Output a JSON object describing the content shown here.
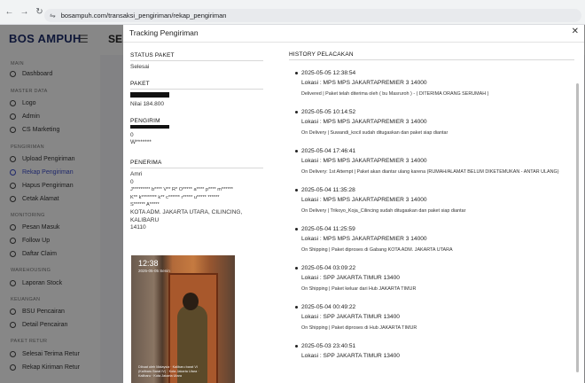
{
  "browser": {
    "url": "bosampuh.com/transaksi_pengiriman/rekap_pengiriman"
  },
  "sidebar": {
    "brand": "BOS AMPUH",
    "sections": [
      {
        "label": "MAIN"
      },
      {
        "label": "MASTER DATA"
      },
      {
        "label": "PENGIRIMAN"
      },
      {
        "label": "MONITORING"
      },
      {
        "label": "WAREHOUSING"
      },
      {
        "label": "KEUANGAN"
      },
      {
        "label": "PAKET RETUR"
      }
    ],
    "items": [
      {
        "label": "Dashboard"
      },
      {
        "label": "Logo"
      },
      {
        "label": "Admin"
      },
      {
        "label": "CS Marketing"
      },
      {
        "label": "Upload Pengiriman"
      },
      {
        "label": "Rekap Pengiriman"
      },
      {
        "label": "Hapus Pengiriman"
      },
      {
        "label": "Cetak Alamat"
      },
      {
        "label": "Pesan Masuk"
      },
      {
        "label": "Follow Up"
      },
      {
        "label": "Daftar Claim"
      },
      {
        "label": "Laporan Stock"
      },
      {
        "label": "BSU Pencairan"
      },
      {
        "label": "Detail Pencairan"
      },
      {
        "label": "Selesai Terima Retur"
      },
      {
        "label": "Rekap Kiriman Retur"
      }
    ]
  },
  "background": {
    "title": "SE"
  },
  "modal": {
    "title": "Tracking Pengiriman",
    "status_label": "STATUS PAKET",
    "status_value": "Selesai",
    "paket_label": "PAKET",
    "paket_value": "Nilai 184.800",
    "pengirim_label": "PENGIRIM",
    "pengirim_line1": "0",
    "pengirim_line2": "W*******",
    "penerima_label": "PENERIMA",
    "penerima_name": "Amri",
    "penerima_phone": "0",
    "penerima_addr1": "J********* b**** V** R* O***** a**** p**** m******",
    "penerima_addr2": "K** k******** k** c****** r***** u***** ******",
    "penerima_addr3": "S****** A*****",
    "penerima_city": "KOTA ADM. JAKARTA UTARA, CILINCING,",
    "penerima_district": "KALIBARU",
    "penerima_zip": "14110",
    "photo": {
      "time": "12:38",
      "date": "2025-05-05 Senin",
      "caption": "Dibuat oleh Malaysia · Kalibaru barat VI (Kalibaru Barat IV) · Kota Jakarta Utara · Kalibaru · Kota Jakarta Utara"
    },
    "history_label": "HISTORY PELACAKAN",
    "history": [
      {
        "date": "2025-05-05 12:38:54",
        "loc": "Lokasi : MPS MPS JAKARTAPREMIER 3 14000",
        "status": "Delivered | Paket telah diterima oleh ( bu Masruroh ) - ( DITERIMA ORANG SERUMAH )"
      },
      {
        "date": "2025-05-05 10:14:52",
        "loc": "Lokasi : MPS MPS JAKARTAPREMIER 3 14000",
        "status": "On Delivery | Suwandi_kocil sudah ditugaskan dan paket siap diantar"
      },
      {
        "date": "2025-05-04 17:46:41",
        "loc": "Lokasi : MPS MPS JAKARTAPREMIER 3 14000",
        "status": "On Delivery: 1st Attempt | Paket akan diantar ulang karena (RUMAH/ALAMAT BELUM DIKETEMUKAN - ANTAR ULANG)"
      },
      {
        "date": "2025-05-04 11:35:28",
        "loc": "Lokasi : MPS MPS JAKARTAPREMIER 3 14000",
        "status": "On Delivery | Trikoyo_Koja_Cilincing sudah ditugaskan dan paket siap diantar"
      },
      {
        "date": "2025-05-04 11:25:59",
        "loc": "Lokasi : MPS MPS JAKARTAPREMIER 3 14000",
        "status": "On Shipping | Paket diproses di Gabang KOTA ADM. JAKARTA UTARA"
      },
      {
        "date": "2025-05-04 03:09:22",
        "loc": "Lokasi : SPP JAKARTA TIMUR 13400",
        "status": "On Shipping | Paket keluar dari Hub JAKARTA TIMUR"
      },
      {
        "date": "2025-05-04 00:49:22",
        "loc": "Lokasi : SPP JAKARTA TIMUR 13400",
        "status": "On Shipping | Paket diproses di Hub JAKARTA TIMUR"
      },
      {
        "date": "2025-05-03 23:40:51",
        "loc": "Lokasi : SPP JAKARTA TIMUR 13400",
        "status": ""
      }
    ]
  },
  "colors": {
    "brand": "#1d2d6b",
    "active": "#3b4cca",
    "overlay": "rgba(0,0,0,0.47)"
  }
}
